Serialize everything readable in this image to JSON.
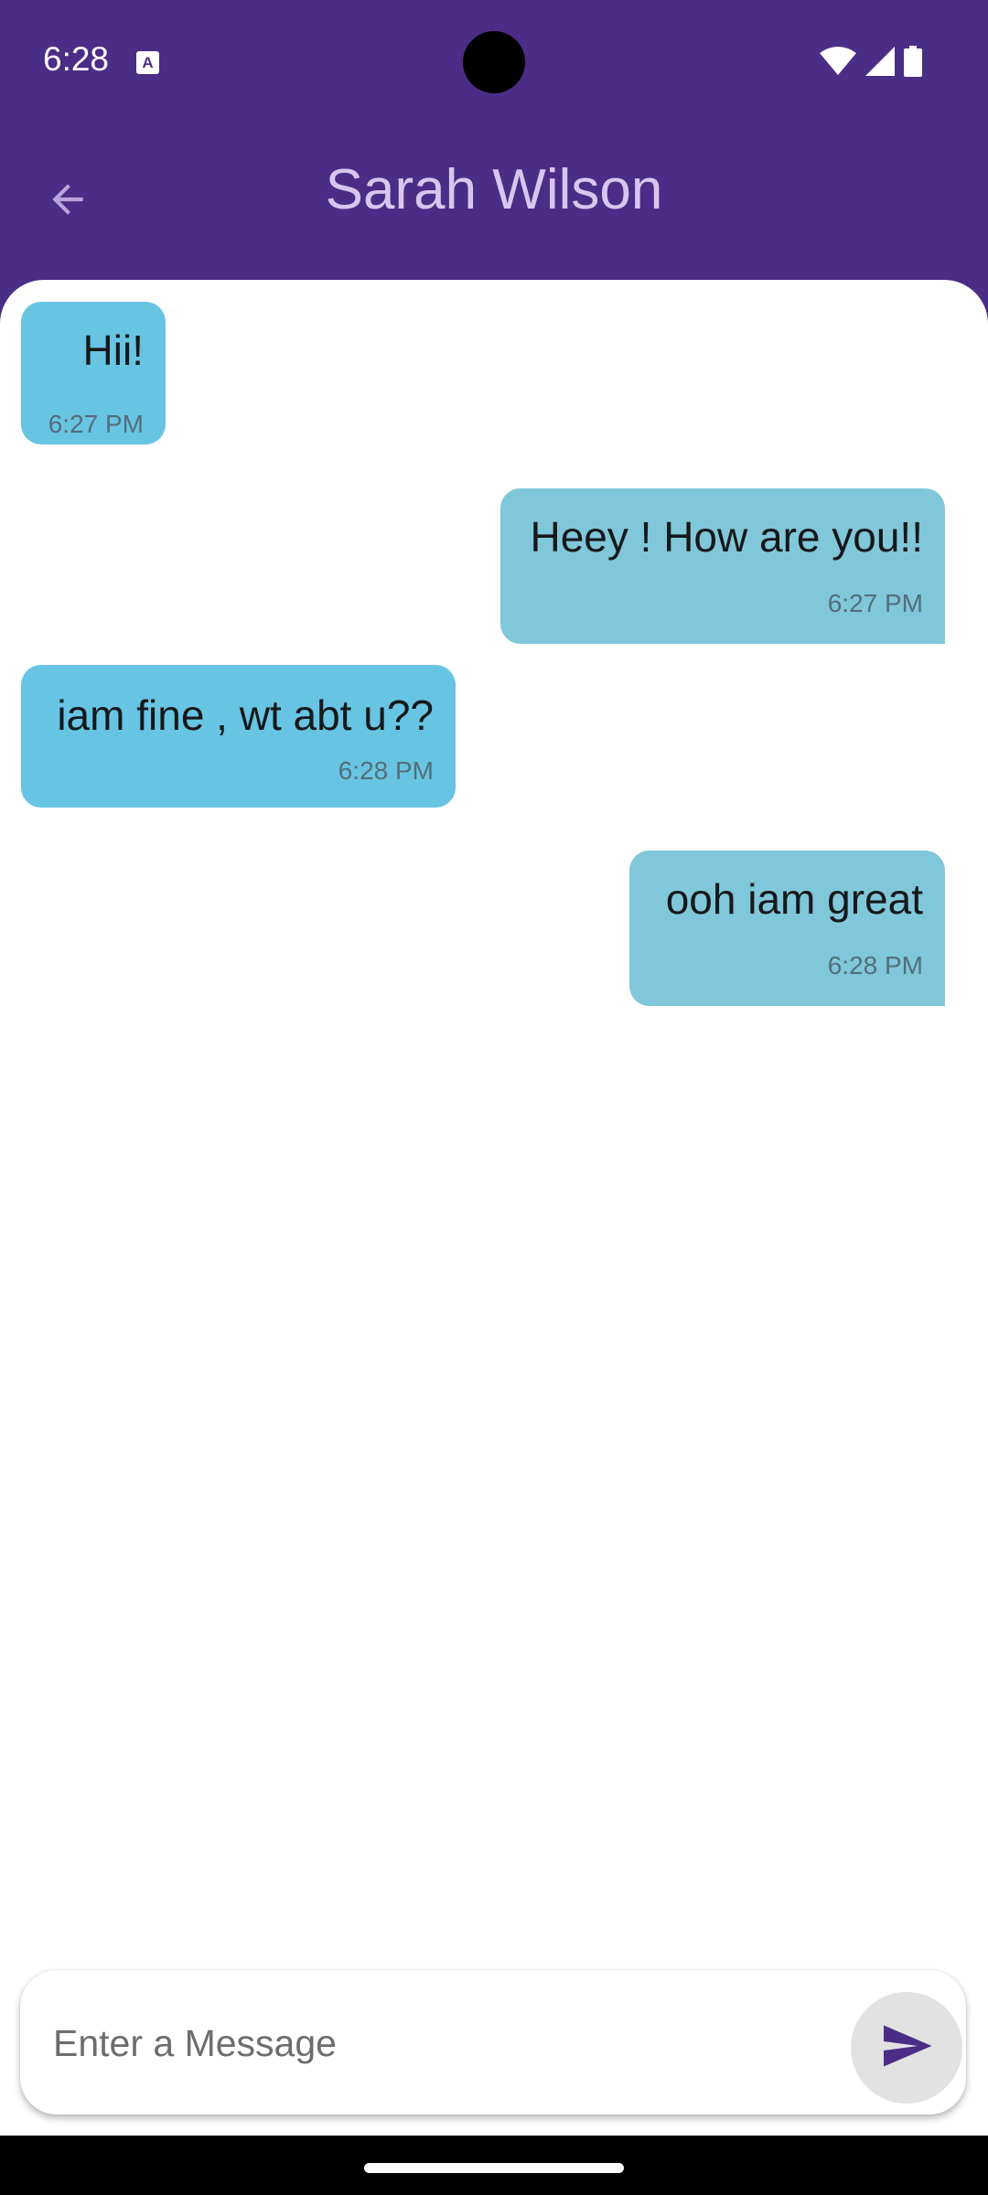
{
  "status_bar": {
    "time": "6:28",
    "notification_icon_letter": "A",
    "icons": [
      "wifi-icon",
      "signal-icon",
      "battery-icon"
    ]
  },
  "app_bar": {
    "title": "Sarah Wilson",
    "back_icon": "arrow-back-icon"
  },
  "messages": [
    {
      "direction": "incoming",
      "text": "Hii!",
      "time": "6:27 PM"
    },
    {
      "direction": "outgoing",
      "text": "Heey ! How are you!!",
      "time": "6:27 PM"
    },
    {
      "direction": "incoming",
      "text": "iam fine , wt abt u??",
      "time": "6:28 PM"
    },
    {
      "direction": "outgoing",
      "text": "ooh iam great",
      "time": "6:28 PM"
    }
  ],
  "composer": {
    "placeholder": "Enter a Message",
    "value": "",
    "send_icon": "send-icon"
  },
  "colors": {
    "header_background": "#4a2d86",
    "incoming_bubble": "#67c5e3",
    "outgoing_bubble": "#80c7da",
    "send_icon": "#4a2d86"
  }
}
